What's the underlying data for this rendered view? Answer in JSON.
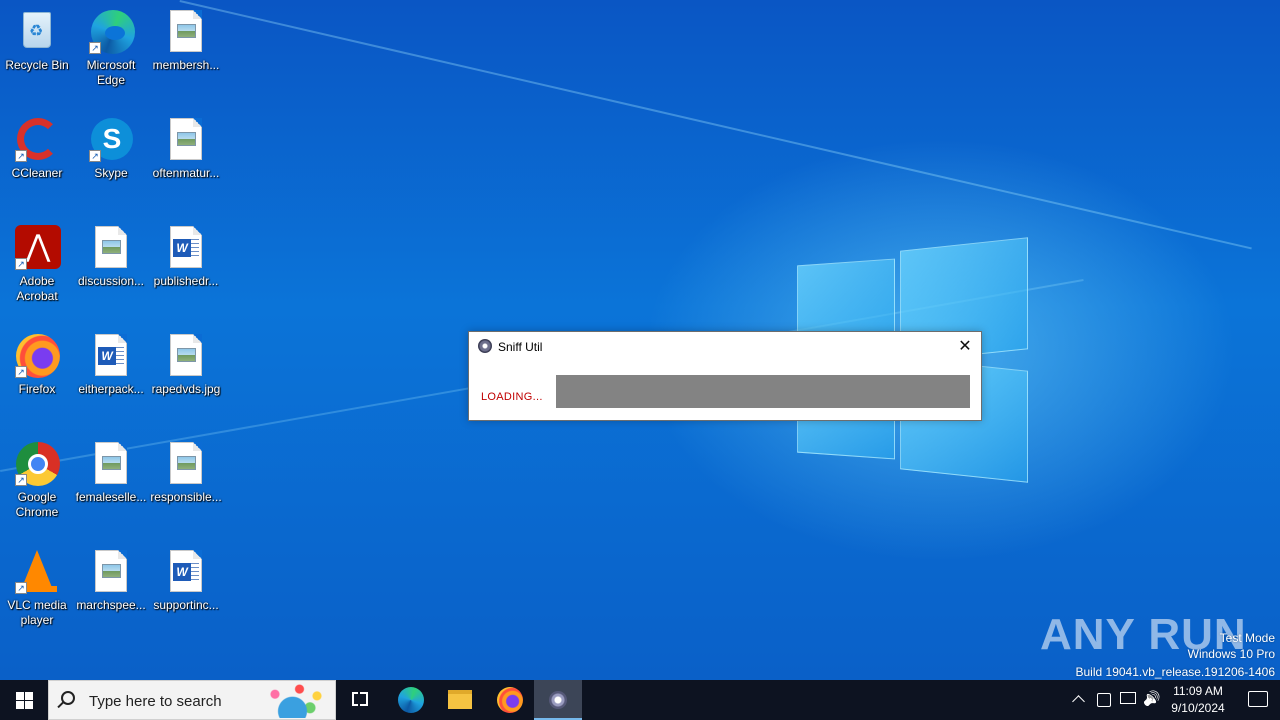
{
  "desktop": {
    "icons": [
      {
        "label": "Recycle Bin",
        "icon": "recycle-bin-icon"
      },
      {
        "label": "Microsoft Edge",
        "icon": "edge-icon"
      },
      {
        "label": "membersh...",
        "icon": "image-file-icon"
      },
      {
        "label": "CCleaner",
        "icon": "ccleaner-icon"
      },
      {
        "label": "Skype",
        "icon": "skype-icon"
      },
      {
        "label": "oftenmatur...",
        "icon": "image-file-icon"
      },
      {
        "label": "Adobe Acrobat",
        "icon": "acrobat-icon"
      },
      {
        "label": "discussion...",
        "icon": "image-file-icon"
      },
      {
        "label": "publishedr...",
        "icon": "word-file-icon"
      },
      {
        "label": "Firefox",
        "icon": "firefox-icon"
      },
      {
        "label": "eitherpack...",
        "icon": "word-file-icon"
      },
      {
        "label": "rapedvds.jpg",
        "icon": "image-file-icon"
      },
      {
        "label": "Google Chrome",
        "icon": "chrome-icon"
      },
      {
        "label": "femaleselle...",
        "icon": "image-file-icon"
      },
      {
        "label": "responsible...",
        "icon": "image-file-icon"
      },
      {
        "label": "VLC media player",
        "icon": "vlc-icon"
      },
      {
        "label": "marchspee...",
        "icon": "image-file-icon"
      },
      {
        "label": "supportinc...",
        "icon": "word-file-icon"
      }
    ]
  },
  "dialog": {
    "title": "Sniff Util",
    "close_symbol": "✕",
    "status": "LOADING...",
    "progress_fraction": 1.0,
    "status_color": "#c00000"
  },
  "watermark": {
    "brand": "ANY RUN",
    "line1": "Test Mode",
    "line2": "Windows 10 Pro",
    "line3": "Build 19041.vb_release.191206-1406"
  },
  "taskbar": {
    "search_placeholder": "Type here to search",
    "pinned": [
      "task-view-icon",
      "edge-icon",
      "file-explorer-icon",
      "firefox-icon",
      "sniff-util-icon"
    ],
    "clock_time": "11:09 AM",
    "clock_date": "9/10/2024"
  }
}
